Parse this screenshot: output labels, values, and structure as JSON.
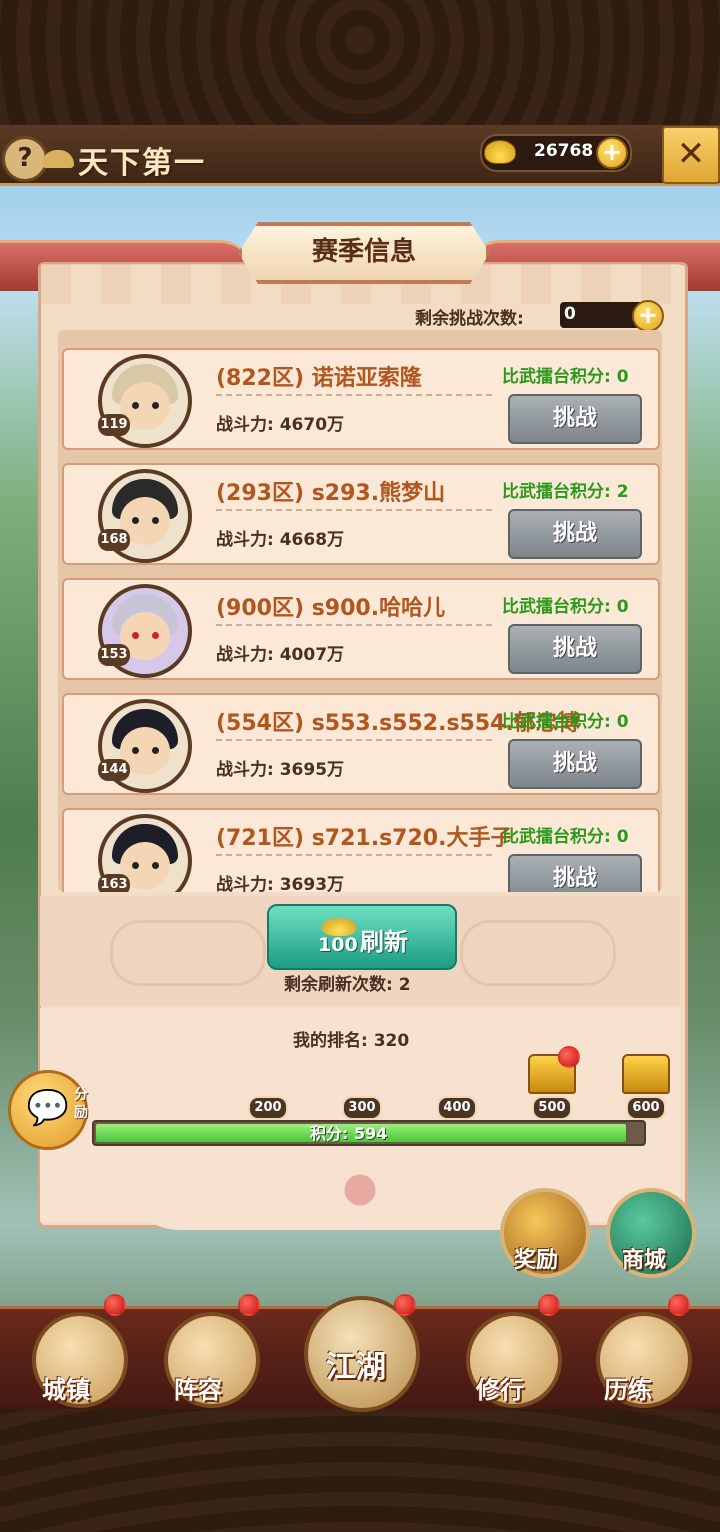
{
  "header": {
    "help_label": "?",
    "title": "天下第一",
    "gold_amount": "26768",
    "add_label": "+",
    "close_label": "✕"
  },
  "panel": {
    "tab_title": "赛季信息",
    "remaining_label": "剩余挑战次数:",
    "remaining_value": "0"
  },
  "opponents": [
    {
      "name": "(822区) 诺诺亚索隆",
      "power": "战斗力: 4670万",
      "score": "比武擂台积分: 0",
      "level": "119",
      "button": "挑战",
      "hair_color": "#d8c8a8"
    },
    {
      "name": "(293区) s293.熊梦山",
      "power": "战斗力: 4668万",
      "score": "比武擂台积分: 2",
      "level": "168",
      "button": "挑战",
      "hair_color": "#2a2a2a"
    },
    {
      "name": "(900区) s900.哈哈儿",
      "power": "战斗力: 4007万",
      "score": "比武擂台积分: 0",
      "level": "153",
      "button": "挑战",
      "hair_color": "#c8c4d8"
    },
    {
      "name": "(554区) s553.s552.s554.郁忠博",
      "power": "战斗力: 3695万",
      "score": "比武擂台积分: 0",
      "level": "144",
      "button": "挑战",
      "hair_color": "#1e1e2a"
    },
    {
      "name": "(721区) s721.s720.大手子",
      "power": "战斗力: 3693万",
      "score": "比武擂台积分: 0",
      "level": "163",
      "button": "挑战",
      "hair_color": "#1e1e2a"
    }
  ],
  "refresh": {
    "label": "刷新",
    "cost": "100",
    "remaining": "剩余刷新次数: 2"
  },
  "ranking": {
    "my_rank": "我的排名: 320",
    "progress_label": "积分: 594",
    "progress_fraction": 0.97,
    "milestones": [
      "200",
      "300",
      "400",
      "500",
      "600"
    ],
    "side_text": "分励"
  },
  "side_buttons": {
    "reward": "奖励",
    "shop": "商城"
  },
  "nav": {
    "town": "城镇",
    "lineup": "阵容",
    "jianghu": "江湖",
    "practice": "修行",
    "training": "历练"
  },
  "colors": {
    "accent_green": "#2a9a1a",
    "name_orange": "#b1561e",
    "refresh_teal": "#1e9c84"
  }
}
